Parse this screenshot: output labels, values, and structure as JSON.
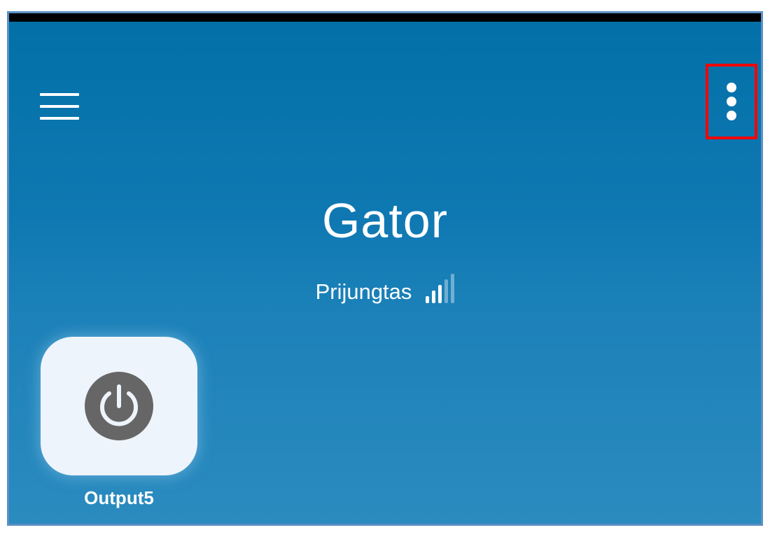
{
  "header": {
    "menu_icon": "hamburger-menu-icon",
    "more_icon": "more-vertical-icon"
  },
  "device": {
    "name": "Gator",
    "status": "Prijungtas",
    "signal_icon": "signal-strength-icon",
    "signal_bars_active": 3,
    "signal_bars_total": 5
  },
  "tiles": [
    {
      "label": "Output5",
      "icon": "power-icon"
    }
  ],
  "colors": {
    "background_top": "#0270a7",
    "background_bottom": "#2a8bbf",
    "tile_background": "#eef4fb",
    "power_icon": "#666666",
    "highlight_border": "#ff0000"
  }
}
